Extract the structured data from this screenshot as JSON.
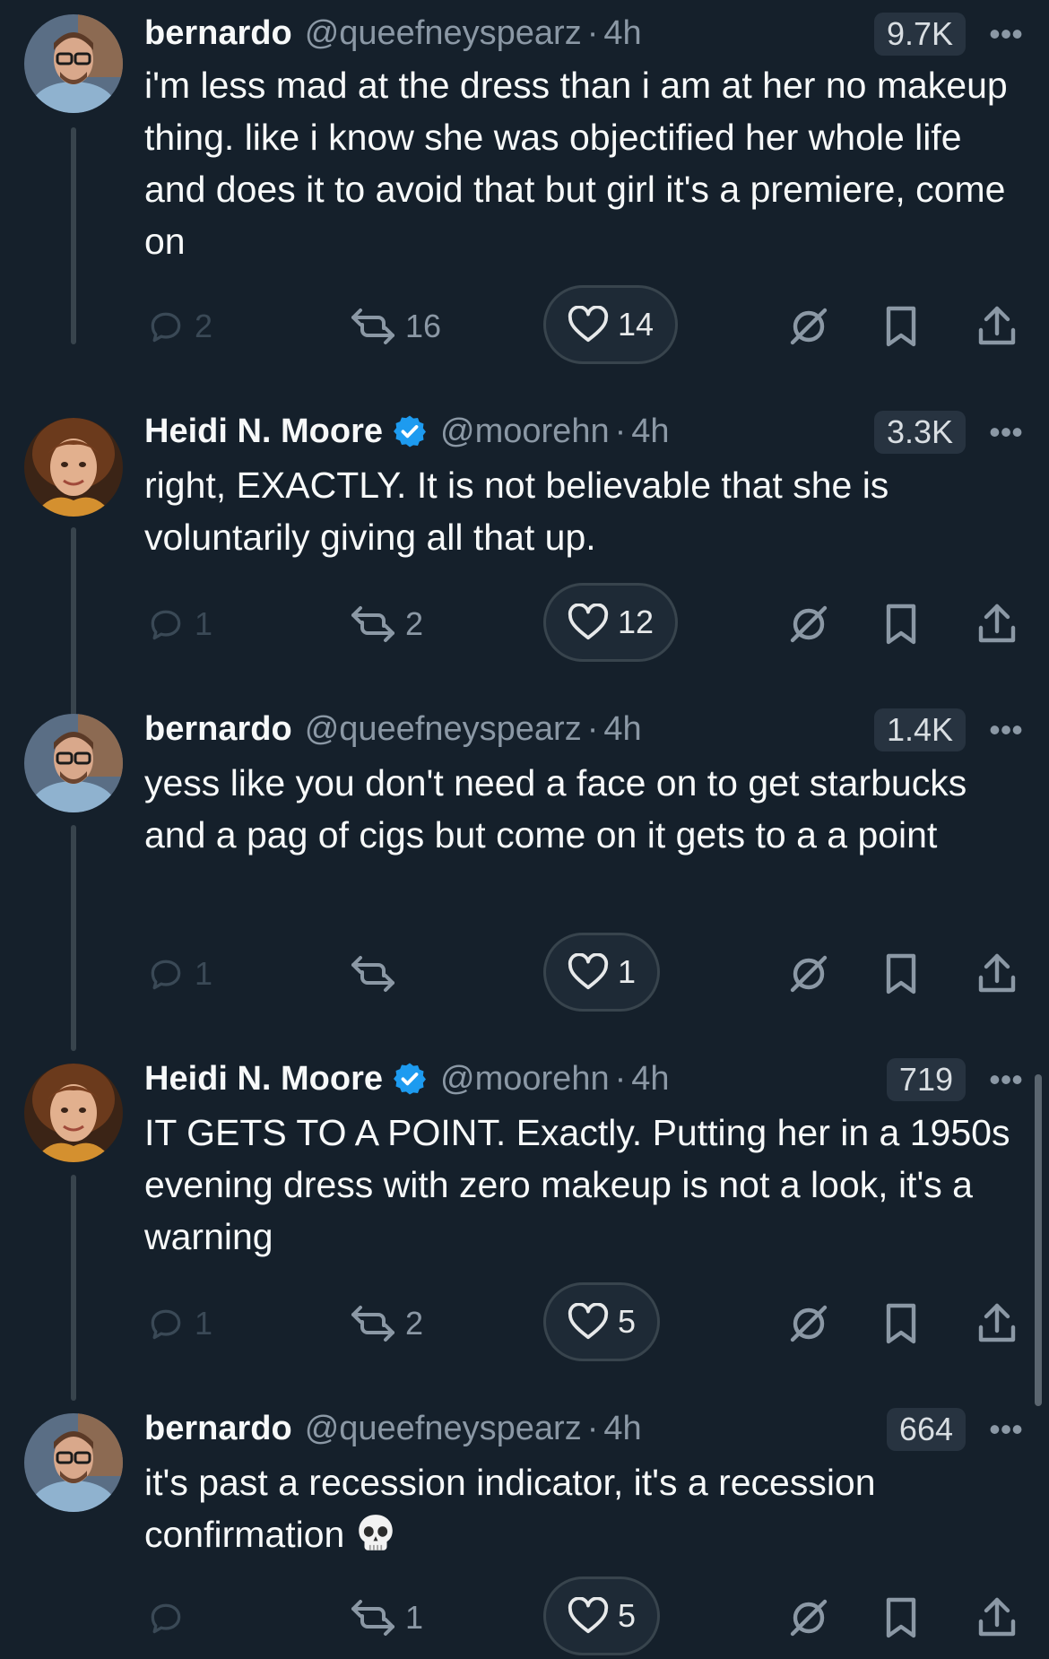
{
  "tweets": [
    {
      "name": "bernardo",
      "handle": "@queefneyspearz",
      "sep": "·",
      "time": "4h",
      "views": "9.7K",
      "verified": false,
      "text": "i'm less mad at the dress than i am at her no makeup thing. like i know she was objectified her whole life and does it to avoid that but girl it's a premiere, come on",
      "replies": "2",
      "retweets": "16",
      "likes": "14"
    },
    {
      "name": "Heidi N. Moore",
      "handle": "@moorehn",
      "sep": "·",
      "time": "4h",
      "views": "3.3K",
      "verified": true,
      "text": "right, EXACTLY. It is not believable that she is voluntarily giving all that up.",
      "replies": "1",
      "retweets": "2",
      "likes": "12"
    },
    {
      "name": "bernardo",
      "handle": "@queefneyspearz",
      "sep": "·",
      "time": "4h",
      "views": "1.4K",
      "verified": false,
      "text": "yess like you don't need a face on to get starbucks and a pag of cigs but come on it gets to a a point",
      "replies": "1",
      "retweets": "",
      "likes": "1"
    },
    {
      "name": "Heidi N. Moore",
      "handle": "@moorehn",
      "sep": "·",
      "time": "4h",
      "views": "719",
      "verified": true,
      "text": "IT GETS TO A POINT. Exactly. Putting her in a 1950s evening dress with zero makeup is not a look, it's a warning",
      "replies": "1",
      "retweets": "2",
      "likes": "5"
    },
    {
      "name": "bernardo",
      "handle": "@queefneyspearz",
      "sep": "·",
      "time": "4h",
      "views": "664",
      "verified": false,
      "text": "it's past a recession indicator, it's a recession confirmation",
      "emoji": "skull",
      "replies": "",
      "retweets": "1",
      "likes": "5"
    }
  ],
  "icons": {
    "more": "more-dots-icon",
    "reply": "reply-icon",
    "retweet": "retweet-icon",
    "like": "heart-icon",
    "grok": "grok-icon",
    "bookmark": "bookmark-icon",
    "share": "share-icon"
  },
  "colors": {
    "background": "#15202b",
    "verified": "#1d9bf0",
    "secondary_text": "#8b98a5"
  }
}
